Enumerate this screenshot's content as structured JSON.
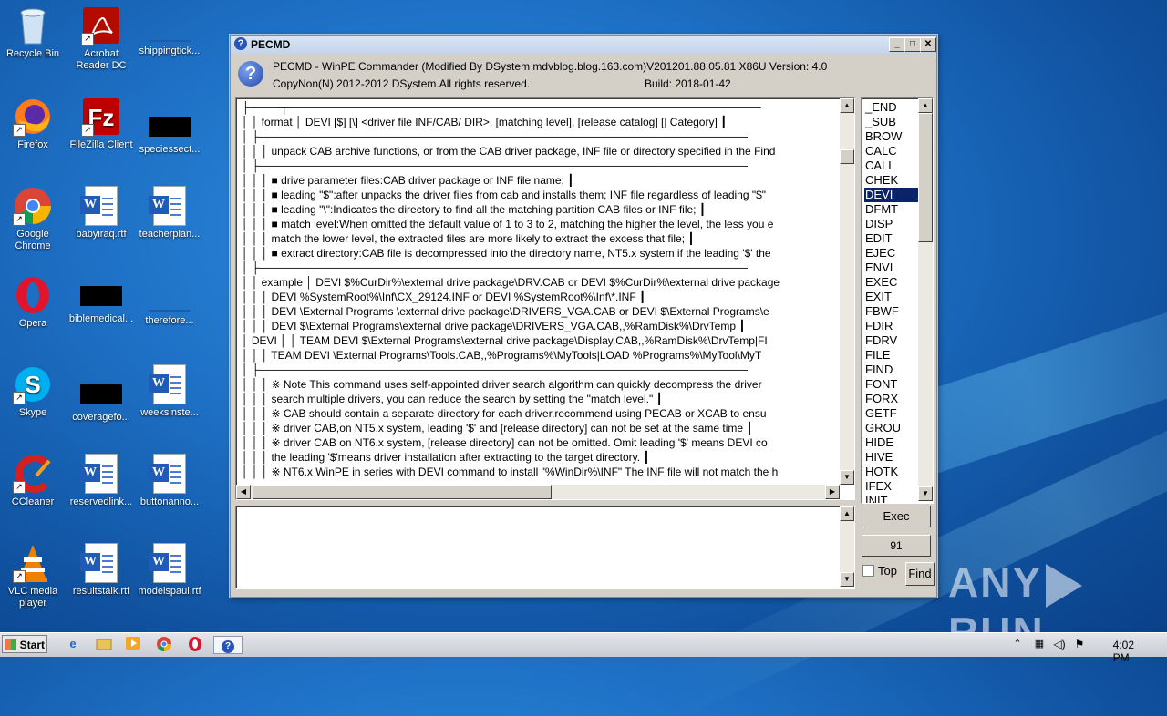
{
  "desktop": {
    "icons": [
      {
        "label": "Recycle Bin"
      },
      {
        "label": "Acrobat Reader DC"
      },
      {
        "label": "shippingtick..."
      },
      {
        "label": "Firefox"
      },
      {
        "label": "FileZilla Client"
      },
      {
        "label": "speciessect..."
      },
      {
        "label": "Google Chrome"
      },
      {
        "label": "babyiraq.rtf"
      },
      {
        "label": "teacherplan..."
      },
      {
        "label": "Opera"
      },
      {
        "label": "biblemedical..."
      },
      {
        "label": "therefore..."
      },
      {
        "label": "Skype"
      },
      {
        "label": "coveragefo..."
      },
      {
        "label": "weeksinste..."
      },
      {
        "label": "CCleaner"
      },
      {
        "label": "reservedlink..."
      },
      {
        "label": "buttonanno..."
      },
      {
        "label": "VLC media player"
      },
      {
        "label": "resultstalk.rtf"
      },
      {
        "label": "modelspaul.rtf"
      }
    ]
  },
  "window": {
    "title": "PECMD",
    "header_line1": "PECMD - WinPE Commander (Modified By DSystem mdvblog.blog.163.com)V201201.88.05.81 X86U  Version: 4.0",
    "header_line2": "CopyNon(N) 2012-2012 DSystem.All rights reserved.",
    "build": "Build: 2018-01-42",
    "lines": [
      "├────┬─────────────────────────────────────────────────────────────",
      "│  │  format  │  DEVI [$] [\\] <driver file INF/CAB/ DIR>, [matching level], [release catalog] [| Category]  ┃",
      "│  ├───────────────────────────────────────────────────────────────",
      "│  │  │  unpack CAB archive functions, or from the CAB driver package, INF file or directory specified in the Find",
      "│  ├───────────────────────────────────────────────────────────────",
      "│  │  │  ■ drive parameter files:CAB driver package or INF file name;  ┃",
      "│  │  │  ■ leading \"$\":after unpacks the driver files from cab and installs them; INF file regardless of leading \"$\"",
      "│  │  │  ■ leading \"\\\":Indicates the directory to find all the matching partition CAB files or INF file;  ┃",
      "│  │  │  ■ match level:When omitted the default value of 1 to 3 to 2, matching the higher the level, the less you e",
      "│  │  │  match the lower level, the extracted files are more likely to extract the excess that file;  ┃",
      "│  │  │  ■ extract directory:CAB file is decompressed into the directory name, NT5.x system if the leading '$' the",
      "│  ├───────────────────────────────────────────────────────────────",
      "│  │  example  │  DEVI $%CurDir%\\external drive package\\DRV.CAB or DEVI $%CurDir%\\external drive package",
      "│  │  │  DEVI %SystemRoot%\\Inf\\CX_29124.INF or DEVI %SystemRoot%\\Inf\\*.INF  ┃",
      "│  │  │  DEVI  \\External Programs \\external drive package\\DRIVERS_VGA.CAB or DEVI $\\External Programs\\e",
      "│  │  │  DEVI $\\External Programs\\external drive package\\DRIVERS_VGA.CAB,,%RamDisk%\\DrvTemp  ┃",
      "│  DEVI  │  │  TEAM DEVI $\\External Programs\\external drive package\\Display.CAB,,%RamDisk%\\DrvTemp|FI",
      "│  │  │  TEAM DEVI \\External Programs\\Tools.CAB,,%Programs%\\MyTools|LOAD %Programs%\\MyTool\\MyT",
      "│  ├───────────────────────────────────────────────────────────────",
      "│  │  │  ※ Note This command uses self-appointed driver search algorithm can quickly decompress the driver",
      "│  │  │  search multiple drivers, you can reduce the search by setting the \"match level.\"  ┃",
      "│  │  │  ※ CAB should contain a separate directory for each driver,recommend using PECAB or XCAB to ensu",
      "│  │  │  ※ driver CAB,on NT5.x system, leading '$' and [release directory] can not be set at the same time  ┃",
      "│  │  │  ※ driver CAB on NT6.x system, [release directory] can not be omitted. Omit leading '$' means DEVI co",
      "│  │  │  the leading '$'means driver installation after extracting to the target directory.  ┃",
      "│  │  │  ※ NT6.x WinPE in series with DEVI command to install \"%WinDir%\\INF\" The INF file will not match the h"
    ],
    "commands": [
      "_END",
      "_SUB",
      "BROW",
      "CALC",
      "CALL",
      "CHEK",
      "DEVI",
      "DFMT",
      "DISP",
      "EDIT",
      "EJEC",
      "ENVI",
      "EXEC",
      "EXIT",
      "FBWF",
      "FDIR",
      "FDRV",
      "FILE",
      "FIND",
      "FONT",
      "FORX",
      "GETF",
      "GROU",
      "HIDE",
      "HIVE",
      "HOTK",
      "IFEX",
      "INIT"
    ],
    "selected_command": "DEVI",
    "exec_label": "Exec",
    "count_value": "91",
    "top_label": "Top",
    "top_checked": false,
    "find_label": "Find",
    "input_value": ""
  },
  "watermark": "ANY RUN",
  "taskbar": {
    "start_label": "Start",
    "clock": "4:02 PM"
  }
}
